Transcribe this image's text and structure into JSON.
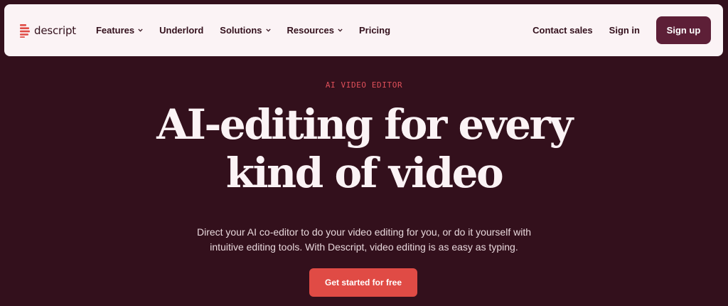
{
  "brand": {
    "name": "descript",
    "logo_icon": "descript-logo-icon",
    "colors": {
      "background": "#33101c",
      "navbar": "#fbf3f5",
      "primary_button": "#5d1f37",
      "accent": "#e04b45",
      "eyebrow": "#e0505a"
    }
  },
  "nav": {
    "items": [
      {
        "label": "Features",
        "has_dropdown": true
      },
      {
        "label": "Underlord",
        "has_dropdown": false
      },
      {
        "label": "Solutions",
        "has_dropdown": true
      },
      {
        "label": "Resources",
        "has_dropdown": true
      },
      {
        "label": "Pricing",
        "has_dropdown": false
      }
    ],
    "contact_sales": "Contact sales",
    "sign_in": "Sign in",
    "sign_up": "Sign up",
    "dropdown_icon": "chevron-down-icon"
  },
  "hero": {
    "eyebrow": "AI VIDEO EDITOR",
    "headline_line1": "AI-editing for every",
    "headline_line2": "kind of video",
    "subtext_line1": "Direct your AI co-editor to do your video editing for you, or do it yourself with",
    "subtext_line2": "intuitive editing tools. With Descript, video editing is as easy as typing.",
    "cta": "Get started for free"
  }
}
